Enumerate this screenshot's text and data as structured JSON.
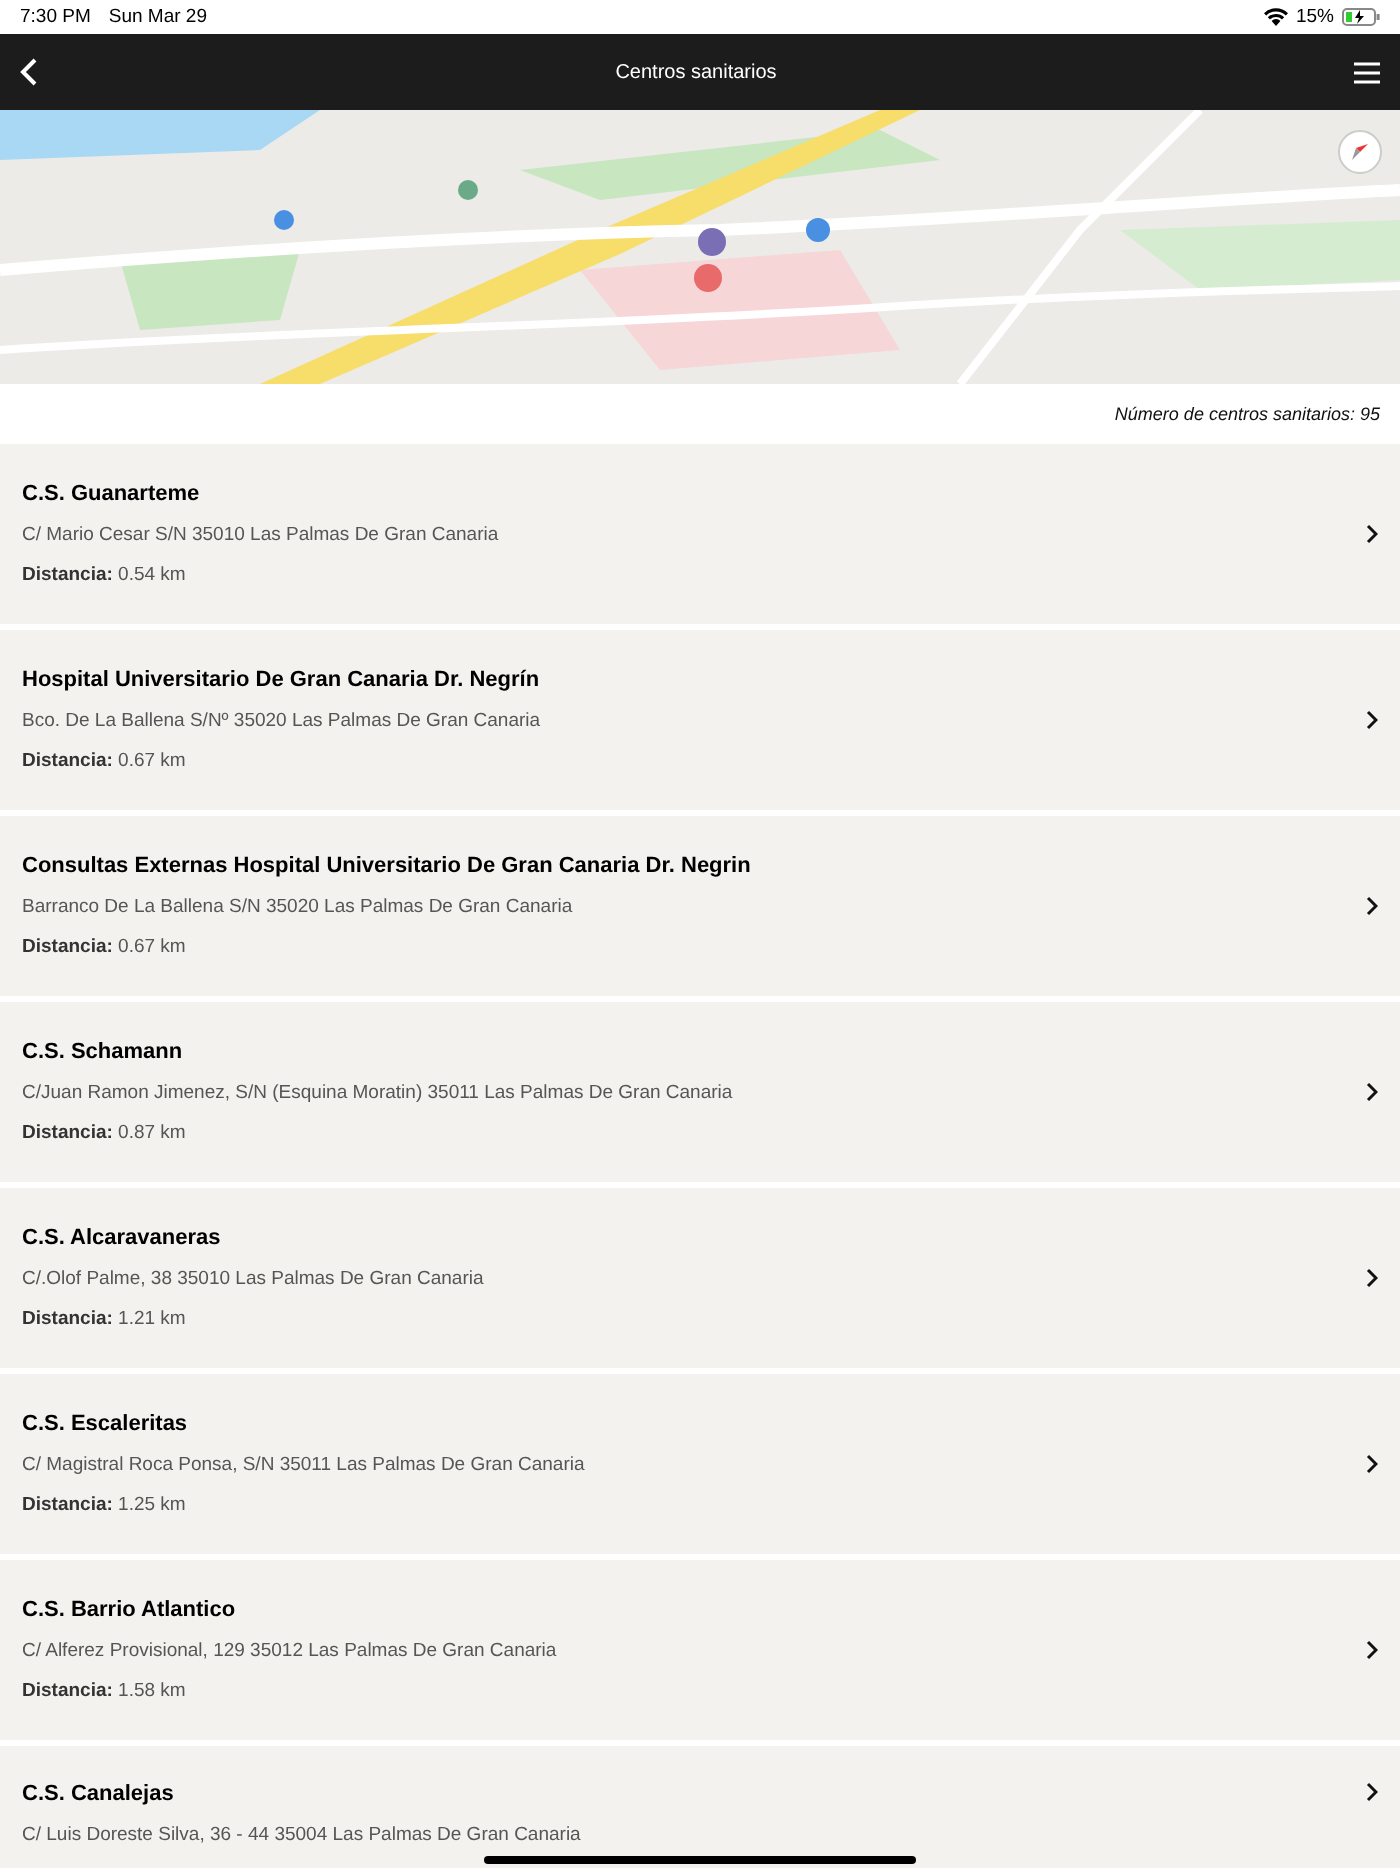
{
  "status_bar": {
    "time": "7:30 PM",
    "date": "Sun Mar 29",
    "battery": "15%"
  },
  "nav_bar": {
    "title": "Centros sanitarios"
  },
  "count": "Número de centros sanitarios: 95",
  "centers": [
    {
      "name": "C.S. Guanarteme",
      "address": "C/ Mario Cesar S/N 35010 Las Palmas De Gran Canaria",
      "distance_label": "Distancia:",
      "distance": "0.54 km"
    },
    {
      "name": "Hospital Universitario De Gran Canaria Dr. Negrín",
      "address": "Bco. De La Ballena S/Nº 35020 Las Palmas De Gran Canaria",
      "distance_label": "Distancia:",
      "distance": "0.67 km"
    },
    {
      "name": "Consultas Externas Hospital Universitario De Gran Canaria Dr. Negrin",
      "address": "Barranco De La Ballena S/N 35020 Las Palmas De Gran Canaria",
      "distance_label": "Distancia:",
      "distance": "0.67 km"
    },
    {
      "name": "C.S. Schamann",
      "address": "C/Juan Ramon Jimenez, S/N (Esquina Moratin) 35011 Las Palmas De Gran Canaria",
      "distance_label": "Distancia:",
      "distance": "0.87 km"
    },
    {
      "name": "C.S. Alcaravaneras",
      "address": "C/.Olof Palme, 38 35010 Las Palmas De Gran Canaria",
      "distance_label": "Distancia:",
      "distance": "1.21 km"
    },
    {
      "name": "C.S. Escaleritas",
      "address": "C/ Magistral Roca Ponsa, S/N 35011 Las Palmas De Gran Canaria",
      "distance_label": "Distancia:",
      "distance": "1.25 km"
    },
    {
      "name": "C.S. Barrio Atlantico",
      "address": "C/ Alferez Provisional, 129 35012 Las Palmas De Gran Canaria",
      "distance_label": "Distancia:",
      "distance": "1.58 km"
    },
    {
      "name": "C.S. Canalejas",
      "address": "C/ Luis Doreste Silva, 36 - 44 35004 Las Palmas De Gran Canaria"
    }
  ]
}
